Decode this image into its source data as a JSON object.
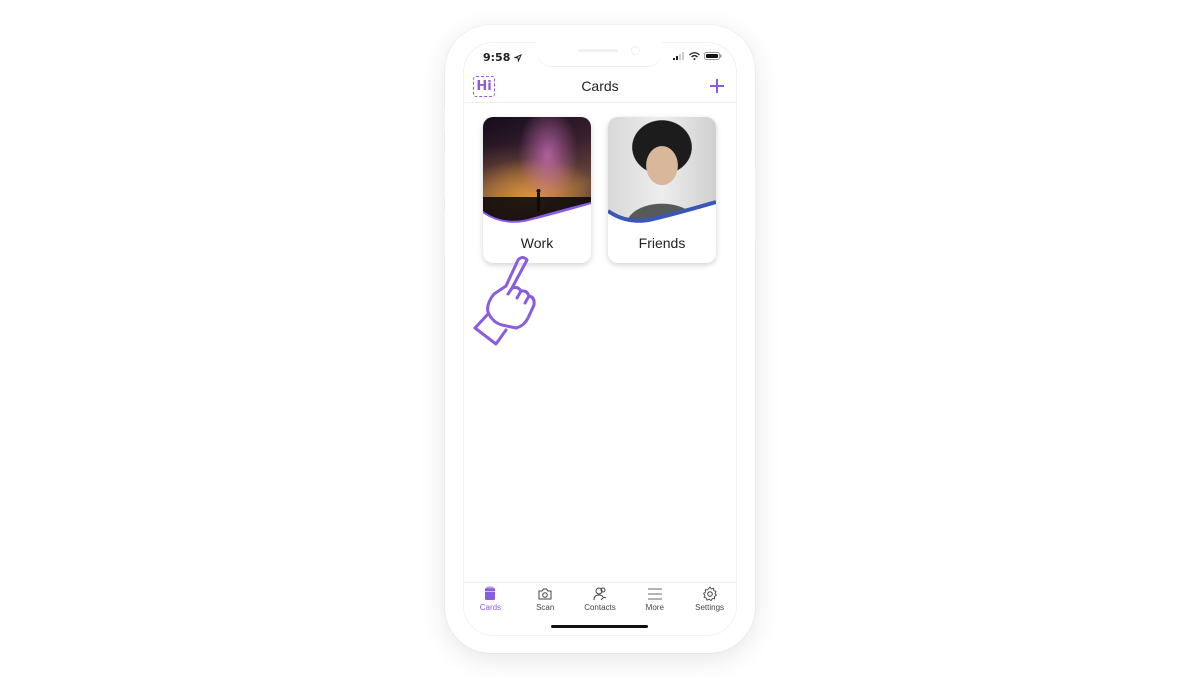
{
  "status_bar": {
    "time": "9:58"
  },
  "header": {
    "logo_text": "Hi",
    "title": "Cards",
    "add_icon": "plus-icon"
  },
  "cards": [
    {
      "label": "Work",
      "image": "milky-way-night-sky",
      "accent": "#8a5cdf"
    },
    {
      "label": "Friends",
      "image": "man-in-black-hat-portrait",
      "accent": "#3a56b8"
    }
  ],
  "tabbar": {
    "items": [
      {
        "label": "Cards",
        "icon": "cards-icon",
        "active": true
      },
      {
        "label": "Scan",
        "icon": "camera-icon",
        "active": false
      },
      {
        "label": "Contacts",
        "icon": "contacts-icon",
        "active": false
      },
      {
        "label": "More",
        "icon": "menu-icon",
        "active": false
      },
      {
        "label": "Settings",
        "icon": "gear-icon",
        "active": false
      }
    ]
  },
  "colors": {
    "accent": "#8a5cdf",
    "friends_wave": "#3a56b8"
  }
}
